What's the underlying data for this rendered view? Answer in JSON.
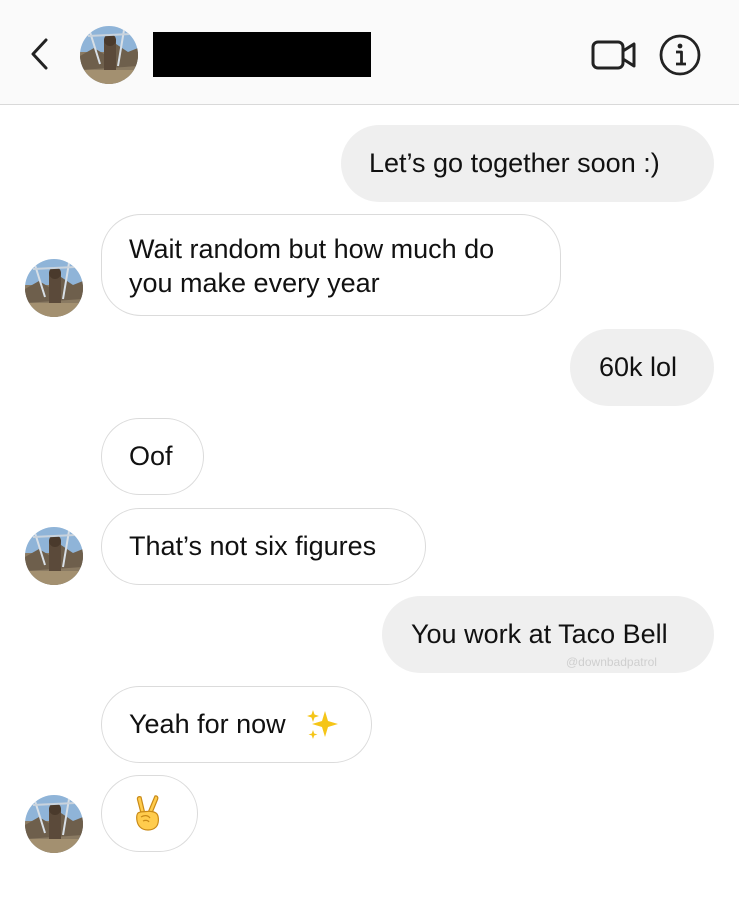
{
  "header": {
    "back_icon": "chevron-left-icon",
    "contact_avatar": "avatar-photo",
    "contact_name_redacted": true,
    "video_call_icon": "video-camera-icon",
    "info_icon": "info-icon"
  },
  "messages": [
    {
      "direction": "outgoing",
      "text": "Let’s go together soon :)"
    },
    {
      "direction": "incoming",
      "lines": [
        "Wait random but how much do",
        "you make every year"
      ]
    },
    {
      "direction": "outgoing",
      "text": "60k lol"
    },
    {
      "direction": "incoming",
      "text": "Oof"
    },
    {
      "direction": "incoming",
      "text": "That’s not six figures"
    },
    {
      "direction": "outgoing",
      "text": "You work at Taco Bell"
    },
    {
      "direction": "incoming",
      "text": "Yeah for now",
      "emoji": "sparkles-icon"
    },
    {
      "direction": "incoming",
      "text": "",
      "emoji": "victory-hand-icon"
    }
  ],
  "watermark": "@downbadpatrol",
  "colors": {
    "outgoing_bubble": "#efefef",
    "incoming_border": "#dbdbdb",
    "header_bg": "#fafafa"
  }
}
